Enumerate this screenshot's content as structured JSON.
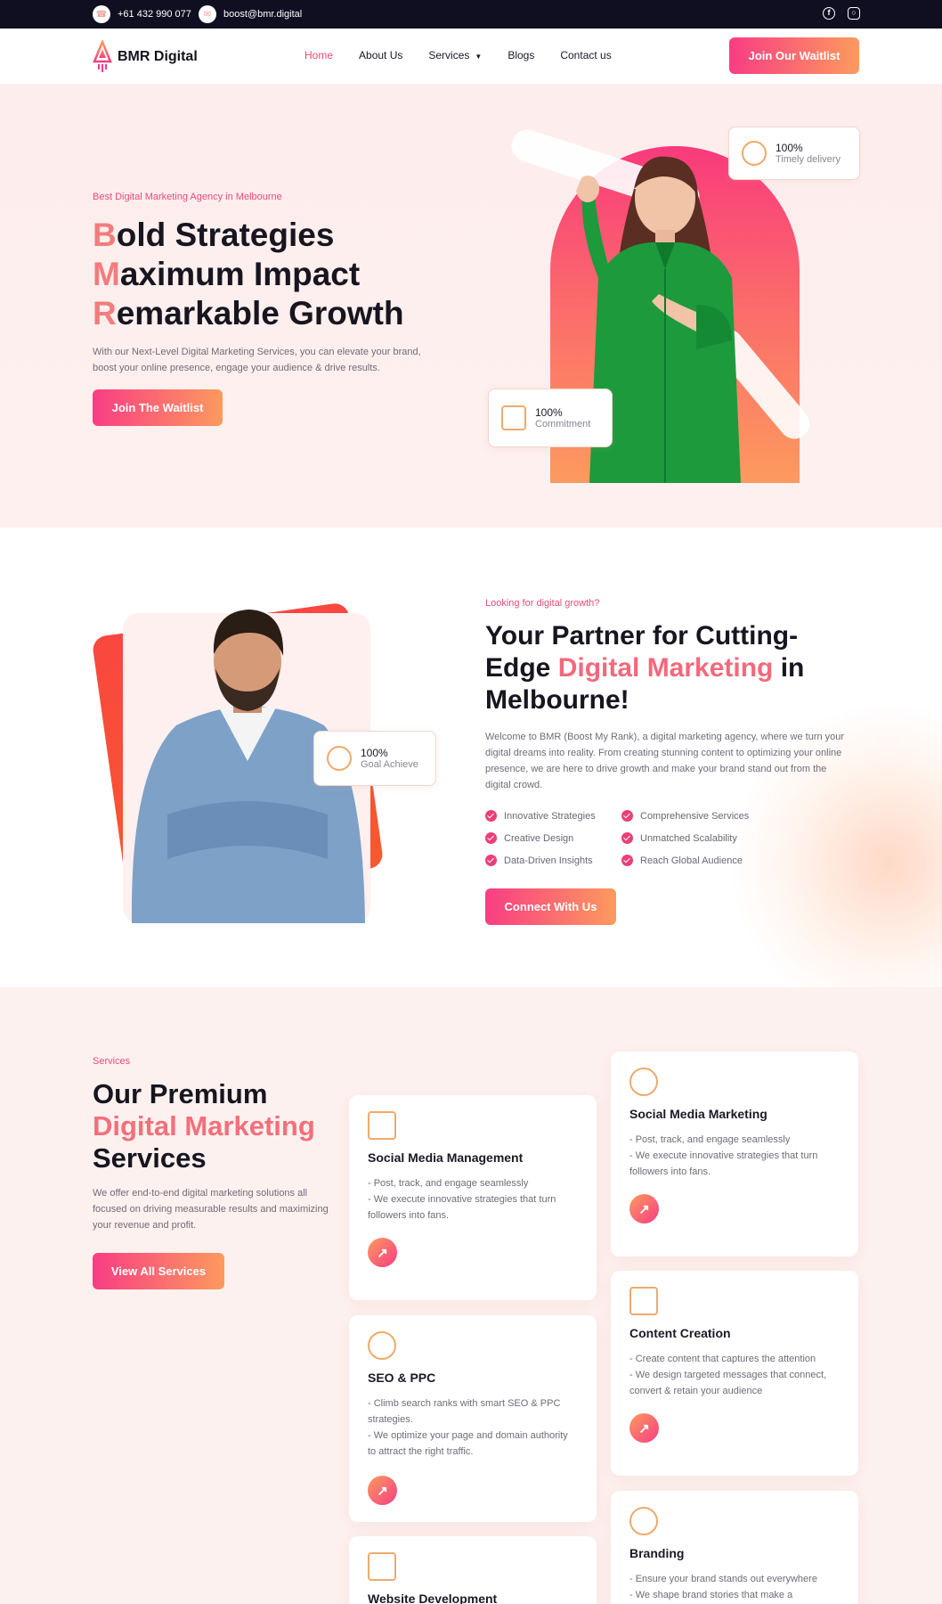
{
  "topbar": {
    "phone": "+61 432 990 077",
    "email": "boost@bmr.digital",
    "social": [
      "facebook-icon",
      "instagram-icon"
    ]
  },
  "nav": {
    "brand": "BMR Digital",
    "items": [
      {
        "label": "Home",
        "active": true
      },
      {
        "label": "About Us"
      },
      {
        "label": "Services",
        "has_dropdown": true
      },
      {
        "label": "Blogs"
      },
      {
        "label": "Contact us"
      }
    ],
    "cta": "Join Our Waitlist"
  },
  "hero": {
    "tagline": "Best Digital Marketing Agency in Melbourne",
    "lines": [
      {
        "first": "B",
        "rest": "old Strategies"
      },
      {
        "first": "M",
        "rest": "aximum Impact"
      },
      {
        "first": "R",
        "rest": "emarkable Growth"
      }
    ],
    "lead": "With our Next-Level Digital Marketing Services, you can elevate your brand, boost your online presence, engage your audience & drive results.",
    "cta": "Join The Waitlist",
    "stat_top": {
      "value": "100%",
      "label": "Timely delivery"
    },
    "stat_bottom": {
      "value": "100%",
      "label": "Commitment"
    }
  },
  "partner": {
    "tagline": "Looking for digital growth?",
    "title_a": "Your Partner for Cutting-Edge ",
    "title_hl": "Digital Marketing",
    "title_b": " in Melbourne!",
    "body": "Welcome to BMR (Boost My Rank), a digital marketing agency, where we turn your digital dreams into reality. From creating stunning content to optimizing your online presence, we are here to drive growth and make your brand stand out from the digital crowd.",
    "checks": [
      "Innovative Strategies",
      "Comprehensive Services",
      "Creative Design",
      "Unmatched Scalability",
      "Data-Driven Insights",
      "Reach Global Audience"
    ],
    "cta": "Connect With Us",
    "stat": {
      "value": "100%",
      "label": "Goal Achieve"
    }
  },
  "services": {
    "tagline": "Services",
    "title_a": "Our Premium",
    "title_hl": "Digital Marketing",
    "title_b": "Services",
    "lead": "We offer end-to-end digital marketing solutions all focused on driving measurable results and maximizing your revenue and profit.",
    "cta": "View All Services",
    "cards": [
      {
        "title": "Social Media Management",
        "lines": [
          "- Post, track, and engage seamlessly",
          "- We execute innovative strategies that turn followers into fans."
        ],
        "icon": "document-icon"
      },
      {
        "title": "Social Media Marketing",
        "lines": [
          "- Post, track, and engage seamlessly",
          "- We execute innovative strategies that turn followers into fans."
        ],
        "icon": "share-icon"
      },
      {
        "title": "SEO & PPC",
        "lines": [
          "- Climb search ranks with smart SEO & PPC strategies.",
          "- We optimize your page and domain authority to attract the right traffic."
        ],
        "icon": "seo-icon"
      },
      {
        "title": "Content Creation",
        "lines": [
          "- Create content that captures the attention",
          "- We design targeted messages that connect, convert & retain your audience"
        ],
        "icon": "content-icon"
      },
      {
        "title": "Website Development",
        "lines": [],
        "icon": "monitor-icon"
      },
      {
        "title": "Branding",
        "lines": [
          "- Ensure your brand stands out everywhere",
          "- We shape brand stories that make a"
        ],
        "icon": "badge-icon"
      }
    ]
  },
  "colors": {
    "accent": "#ec4a78",
    "gradient_start": "#f83d83",
    "gradient_end": "#fd9a5e",
    "dark": "#100f21"
  }
}
